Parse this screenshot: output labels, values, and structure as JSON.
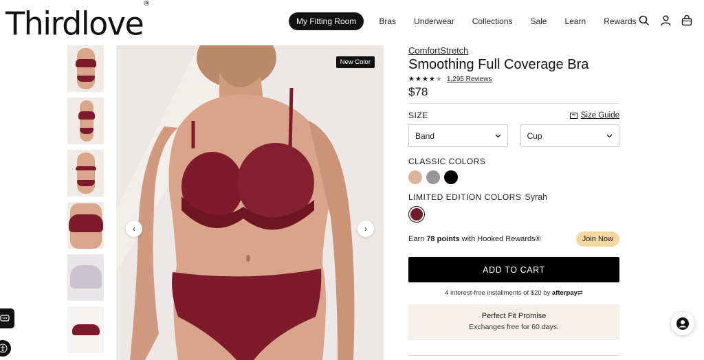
{
  "brand": {
    "logo": "Thirdlove",
    "logo_mark": "®"
  },
  "nav": {
    "fitting_room": "My Fitting Room",
    "items": [
      "Bras",
      "Underwear",
      "Collections",
      "Sale",
      "Learn",
      "Rewards"
    ],
    "icons": [
      "search-icon",
      "account-icon",
      "bag-icon"
    ]
  },
  "gallery": {
    "thumbnail_count": 6,
    "badge": "New Color",
    "prev_icon": "chevron-left-icon",
    "next_icon": "chevron-right-icon"
  },
  "product": {
    "subbrand": "ComfortStretch",
    "title": "Smoothing Full Coverage Bra",
    "rating_stars": 4.5,
    "reviews": "1,295 Reviews",
    "price": "$78"
  },
  "size": {
    "label": "SIZE",
    "guide": "Size Guide",
    "band_placeholder": "Band",
    "cup_placeholder": "Cup"
  },
  "colors": {
    "classic_label": "CLASSIC COLORS",
    "classic_swatches": [
      "#dcb39c",
      "#9a9697",
      "#000000"
    ],
    "limited_label": "LIMITED EDITION COLORS",
    "selected_color": "Syrah",
    "limited_swatches": [
      "#6e1f28"
    ]
  },
  "rewards": {
    "text_prefix": "Earn",
    "points": "78 points",
    "text_suffix": "with Hooked Rewards®",
    "join": "Join Now",
    "join_color": "#f3d9a1"
  },
  "cart": {
    "add_to_cart": "ADD TO CART"
  },
  "afterpay": {
    "text": "4 interest-free installments of $20 by",
    "brand": "afterpay"
  },
  "promise": {
    "title": "Perfect Fit Promise",
    "subtitle": "Exchanges free for 60 days."
  },
  "accent": {
    "primary": "#000000",
    "bra": "#7e1b2a",
    "bg_tint": "#f5f0eb"
  }
}
